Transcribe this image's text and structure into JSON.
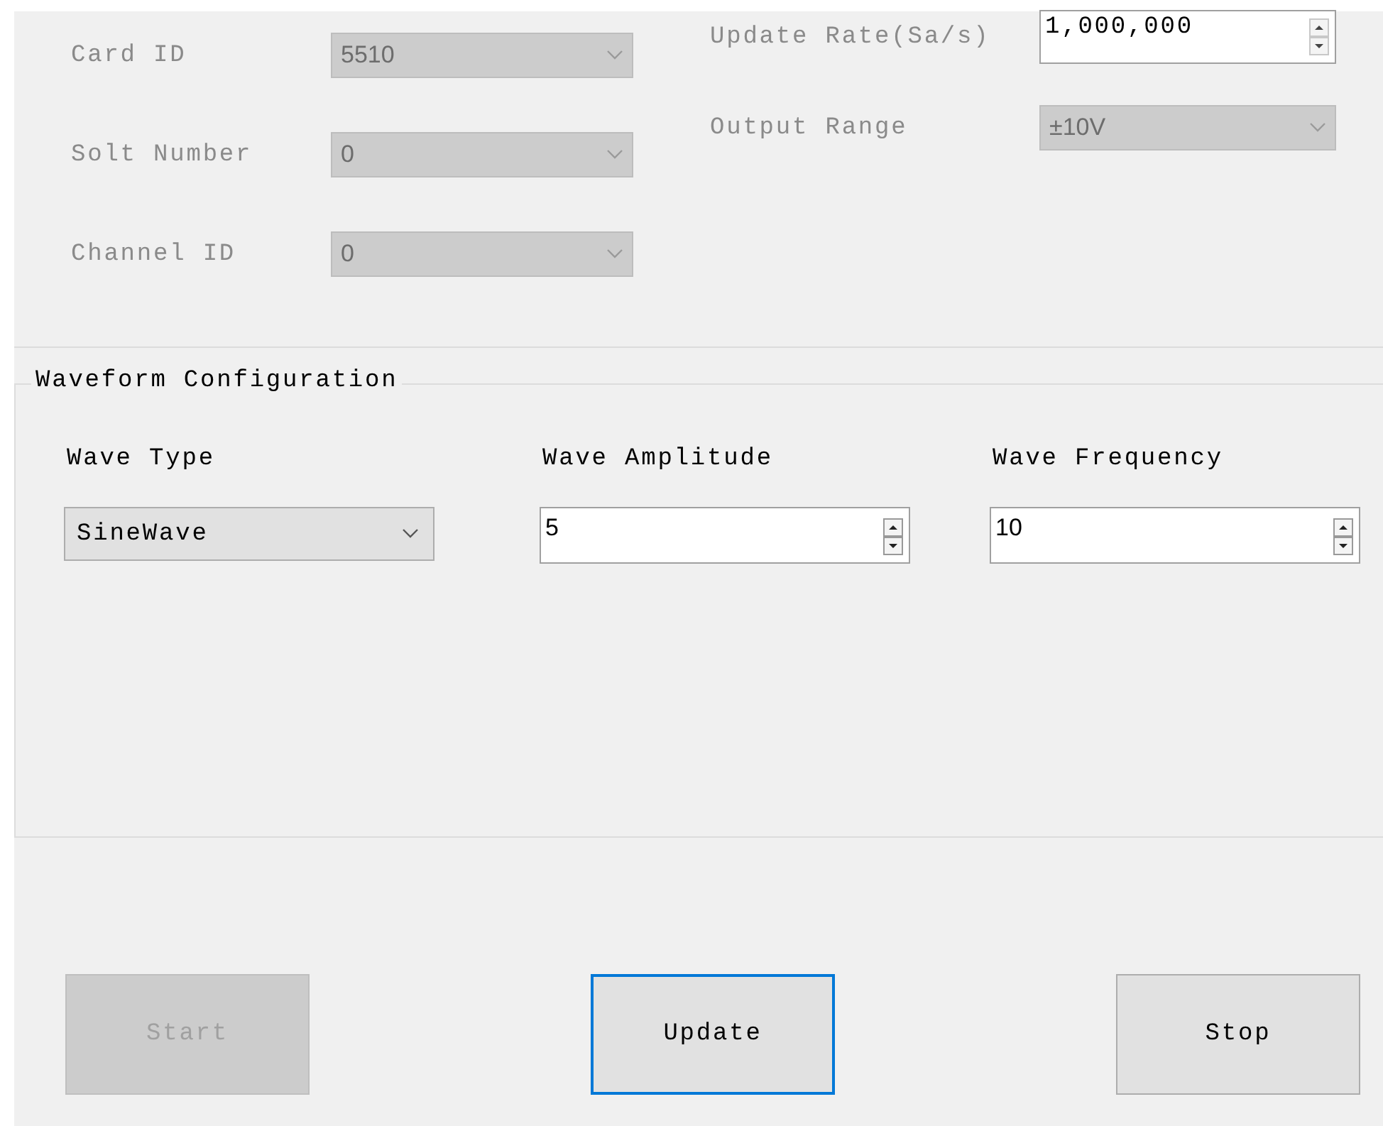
{
  "device": {
    "disabled": true,
    "left": [
      {
        "label": "Card ID",
        "kind": "dropdown",
        "value": "5510"
      },
      {
        "label": "Solt Number",
        "kind": "dropdown",
        "value": "0"
      },
      {
        "label": "Channel ID",
        "kind": "dropdown",
        "value": "0"
      }
    ],
    "right": [
      {
        "label": "Update Rate(Sa/s)",
        "kind": "spinner",
        "value": "1,000,000"
      },
      {
        "label": "Output Range",
        "kind": "dropdown",
        "value": "±10V"
      }
    ]
  },
  "waveform": {
    "title": "Waveform Configuration",
    "fields": [
      {
        "label": "Wave Type",
        "kind": "dropdown",
        "value": "SineWave"
      },
      {
        "label": "Wave Amplitude",
        "kind": "spinner",
        "value": "5"
      },
      {
        "label": "Wave Frequency",
        "kind": "spinner",
        "value": "10"
      }
    ]
  },
  "buttons": [
    {
      "label": "Start",
      "disabled": true,
      "focused": false
    },
    {
      "label": "Update",
      "disabled": false,
      "focused": true
    },
    {
      "label": "Stop",
      "disabled": false,
      "focused": false
    }
  ]
}
